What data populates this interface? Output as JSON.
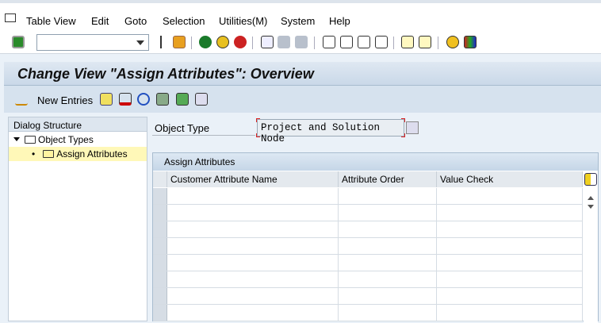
{
  "menu": [
    "Table View",
    "Edit",
    "Goto",
    "Selection",
    "Utilities(M)",
    "System",
    "Help"
  ],
  "command_field": {
    "value": ""
  },
  "title": "Change View \"Assign Attributes\": Overview",
  "app_toolbar": {
    "new_entries": "New Entries"
  },
  "dialog": {
    "header": "Dialog Structure",
    "items": [
      "Object Types",
      "Assign Attributes"
    ]
  },
  "object_type": {
    "label": "Object Type",
    "value": "Project and Solution Node"
  },
  "table": {
    "caption": "Assign Attributes",
    "columns": [
      "Customer Attribute Name",
      "Attribute Order",
      "Value Check"
    ],
    "rows": 8
  }
}
